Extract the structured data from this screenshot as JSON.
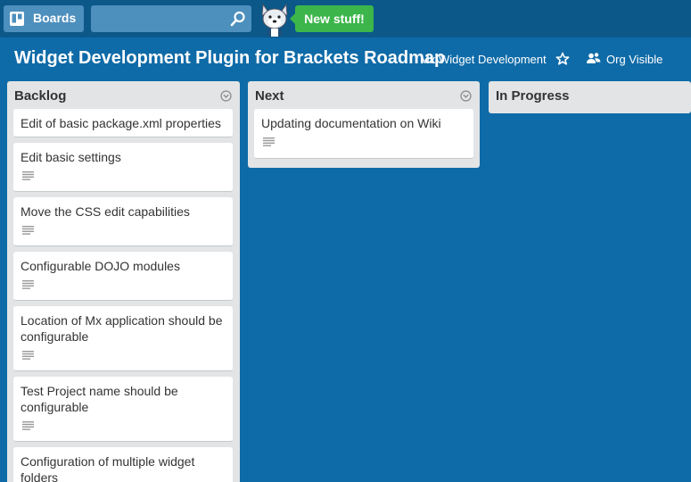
{
  "header": {
    "boards_label": "Boards",
    "search_placeholder": "",
    "new_stuff_label": "New stuff!"
  },
  "board": {
    "title": "Widget Development Plugin for Brackets Roadmap",
    "org_name": "Mx Widget Development",
    "visibility": "Org Visible"
  },
  "lists": [
    {
      "title": "Backlog",
      "cards": [
        {
          "text": "Edit of basic package.xml properties",
          "has_description": false
        },
        {
          "text": "Edit basic settings",
          "has_description": true
        },
        {
          "text": "Move the CSS edit capabilities",
          "has_description": true
        },
        {
          "text": "Configurable DOJO modules",
          "has_description": true
        },
        {
          "text": "Location of Mx application should be configurable",
          "has_description": true
        },
        {
          "text": "Test Project name should be configurable",
          "has_description": true
        },
        {
          "text": "Configuration of multiple widget folders",
          "has_description": false
        }
      ]
    },
    {
      "title": "Next",
      "cards": [
        {
          "text": "Updating documentation on Wiki",
          "has_description": true
        }
      ]
    },
    {
      "title": "In Progress",
      "cards": []
    }
  ],
  "colors": {
    "board_background": "#0f6ba8",
    "header_background": "#0b5889",
    "new_stuff_green": "#3cb64b",
    "list_background": "#e2e4e6"
  },
  "icons": {
    "boards": "trello-boards-icon",
    "search": "magnifier-icon",
    "mascot": "husky-mascot-icon",
    "star": "star-outline-icon",
    "org": "org-people-icon",
    "list_menu": "chevron-circle-icon",
    "description": "description-lines-icon"
  }
}
